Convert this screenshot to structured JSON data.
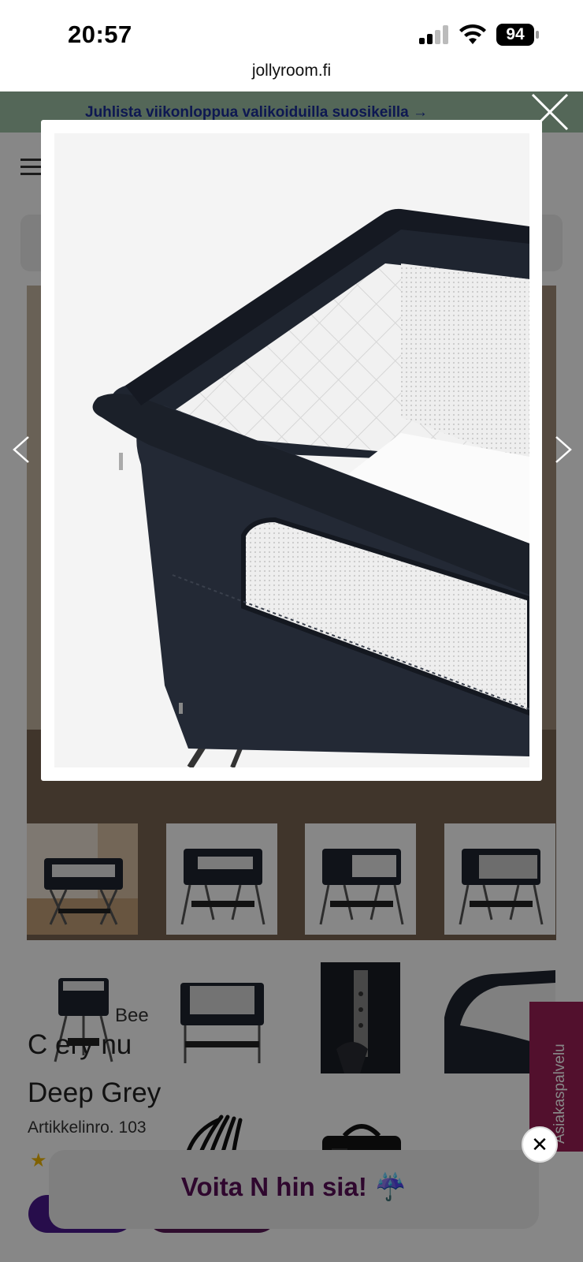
{
  "status_bar": {
    "time": "20:57",
    "battery": "94"
  },
  "browser": {
    "url": "jollyroom.fi"
  },
  "promo": {
    "text": "Juhlista viikonloppua valikoiduilla suosikeilla →"
  },
  "product": {
    "brand_fragment": "Bee",
    "title_line1": "C                 ery          nu",
    "title_line2": "Deep Grey",
    "article_number": "Artikkelinro.  103"
  },
  "customer_service": {
    "label": "Asiakaspalvelu"
  },
  "newsletter": {
    "text": "Voita N          hin          sia! ☔"
  },
  "gallery": {
    "thumbnails": [
      "bassinet-room-photo",
      "bassinet-side-view",
      "bassinet-angle-view",
      "bassinet-open-side",
      "bassinet-front-view",
      "bassinet-open-front",
      "bassinet-leg-detail",
      "bassinet-corner-detail",
      "straps-accessory",
      "carry-bag"
    ]
  },
  "colors": {
    "promo_bg": "#9fc3a7",
    "promo_text": "#1c2f9a",
    "customer_service_bg": "#9b1f56",
    "newsletter_text": "#5a0f57",
    "bassinet_fabric": "#1f2530"
  }
}
